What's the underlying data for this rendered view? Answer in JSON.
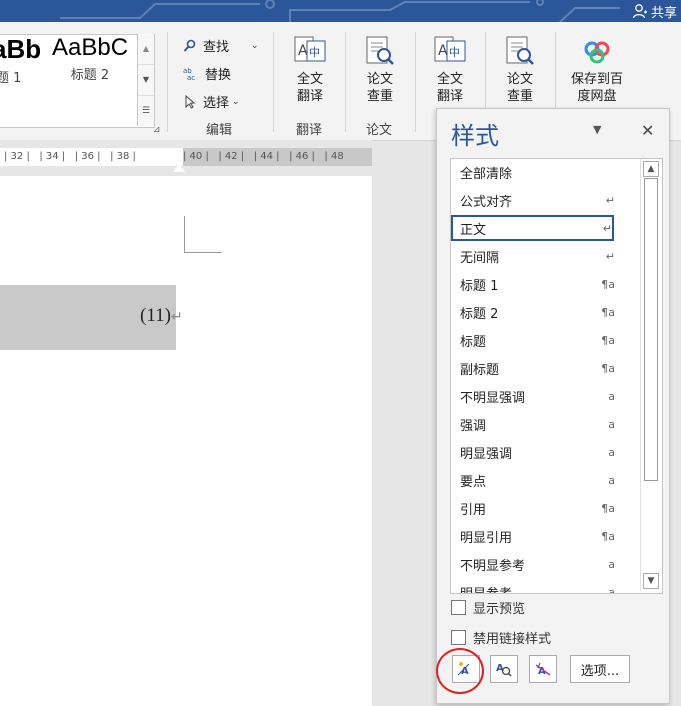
{
  "titlebar": {
    "share_label": "共享"
  },
  "ribbon": {
    "style_gallery": [
      {
        "preview": "aBb",
        "name": "题 1"
      },
      {
        "preview": "AaBbC",
        "name": "标题 2"
      }
    ],
    "edit_group": {
      "find": "查找",
      "replace": "替换",
      "select": "选择",
      "label": "编辑"
    },
    "translate_group": {
      "full_translate": "全文翻译",
      "label": "翻译"
    },
    "paper_group": {
      "paper_check": "论文查重",
      "label": "论文"
    },
    "extra": {
      "full_translate2": "全文翻译",
      "paper_check2": "论文查重",
      "save_baidu": "保存到百度网盘"
    }
  },
  "ruler": {
    "ticks": [
      "32",
      "34",
      "36",
      "38",
      "40",
      "42",
      "44",
      "46",
      "48"
    ]
  },
  "document": {
    "equation_number": "(11)"
  },
  "styles_pane": {
    "title": "样式",
    "items": [
      {
        "label": "全部清除",
        "mark": ""
      },
      {
        "label": "公式对齐",
        "mark": "↵"
      },
      {
        "label": "正文",
        "mark": "↵",
        "selected": true
      },
      {
        "label": "无间隔",
        "mark": "↵"
      },
      {
        "label": "标题 1",
        "mark": "¶a"
      },
      {
        "label": "标题 2",
        "mark": "¶a"
      },
      {
        "label": "标题",
        "mark": "¶a"
      },
      {
        "label": "副标题",
        "mark": "¶a"
      },
      {
        "label": "不明显强调",
        "mark": "a"
      },
      {
        "label": "强调",
        "mark": "a"
      },
      {
        "label": "明显强调",
        "mark": "a"
      },
      {
        "label": "要点",
        "mark": "a"
      },
      {
        "label": "引用",
        "mark": "¶a"
      },
      {
        "label": "明显引用",
        "mark": "¶a"
      },
      {
        "label": "不明显参考",
        "mark": "a"
      },
      {
        "label": "明显参考",
        "mark": "a"
      }
    ],
    "show_preview": "显示预览",
    "disable_linked": "禁用链接样式",
    "options_button": "选项..."
  },
  "colors": {
    "accent": "#2b579a",
    "highlight": "#e02020"
  }
}
